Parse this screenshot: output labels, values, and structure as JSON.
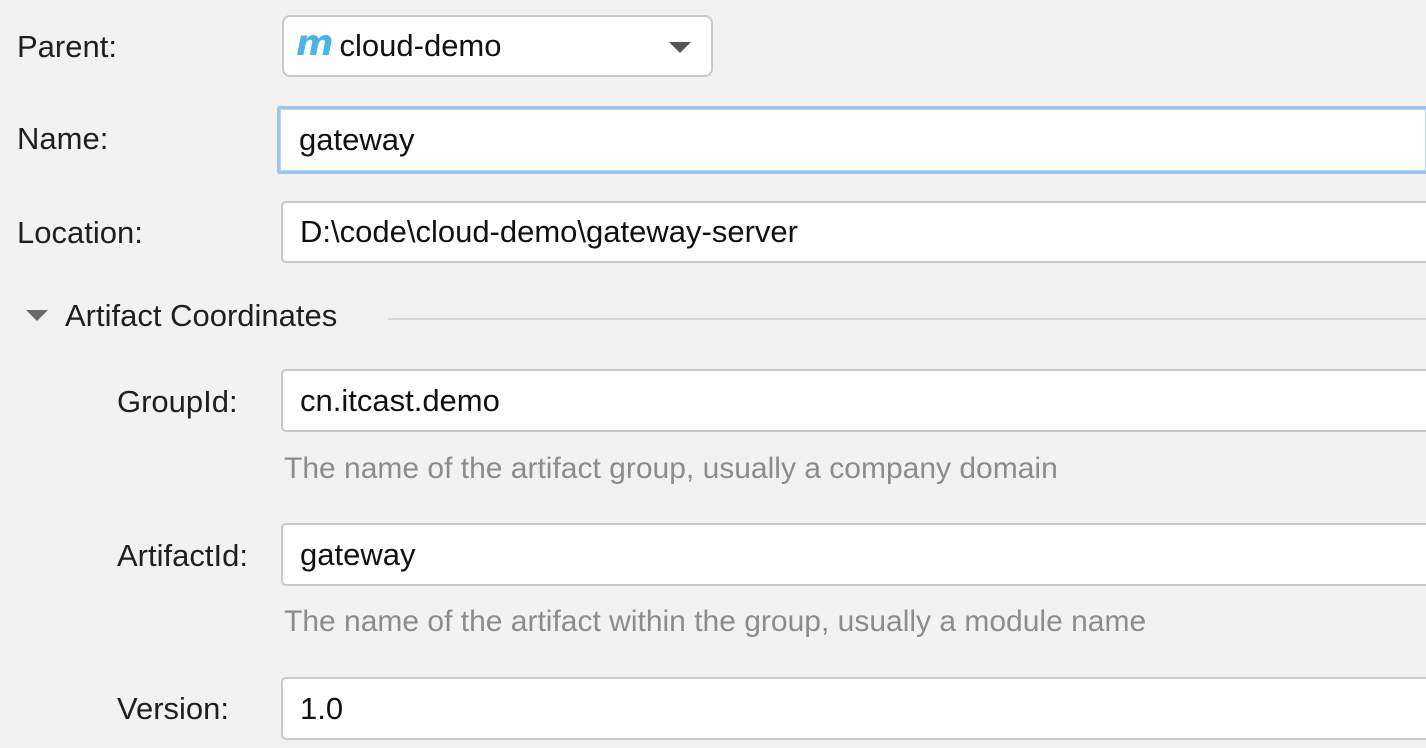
{
  "form": {
    "parent": {
      "label": "Parent:",
      "value": "cloud-demo",
      "icon": "maven-icon",
      "icon_glyph": "m"
    },
    "name": {
      "label": "Name:",
      "value": "gateway"
    },
    "location": {
      "label": "Location:",
      "value": "D:\\code\\cloud-demo\\gateway-server"
    }
  },
  "artifact": {
    "section_title": "Artifact Coordinates",
    "groupId": {
      "label": "GroupId:",
      "value": "cn.itcast.demo",
      "hint": "The name of the artifact group, usually a company domain"
    },
    "artifactId": {
      "label": "ArtifactId:",
      "value": "gateway",
      "hint": "The name of the artifact within the group, usually a module name"
    },
    "version": {
      "label": "Version:",
      "value": "1.0"
    }
  },
  "colors": {
    "background": "#f2f2f2",
    "focus_border": "#9ec3ee",
    "maven_icon": "#49b5e6",
    "hint_text": "#8c8c8c"
  }
}
